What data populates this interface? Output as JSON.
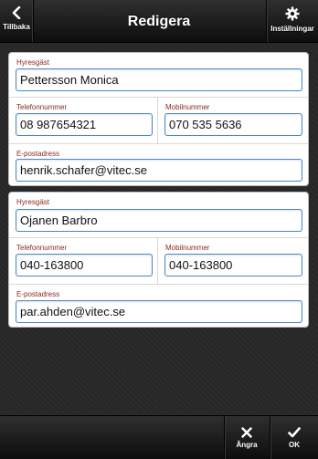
{
  "header": {
    "title": "Redigera",
    "back_label": "Tillbaka",
    "settings_label": "Inställningar"
  },
  "tenants": [
    {
      "tenant_label": "Hyresgäst",
      "tenant_value": "Pettersson Monica",
      "phone_label": "Telefonnummer",
      "phone_value": "08 987654321",
      "mobile_label": "Mobilnummer",
      "mobile_value": "070 535 5636",
      "email_label": "E-postadress",
      "email_value": "henrik.schafer@vitec.se"
    },
    {
      "tenant_label": "Hyresgäst",
      "tenant_value": "Ojanen Barbro",
      "phone_label": "Telefonnummer",
      "phone_value": "040-163800",
      "mobile_label": "Mobilnummer",
      "mobile_value": "040-163800",
      "email_label": "E-postadress",
      "email_value": "par.ahden@vitec.se"
    }
  ],
  "footer": {
    "undo_label": "Ångra",
    "ok_label": "OK"
  },
  "colors": {
    "field_border": "#4a87c8",
    "label": "#8a2a1f"
  },
  "icons": [
    "chevron-left-icon",
    "gear-icon",
    "close-icon",
    "check-icon"
  ]
}
